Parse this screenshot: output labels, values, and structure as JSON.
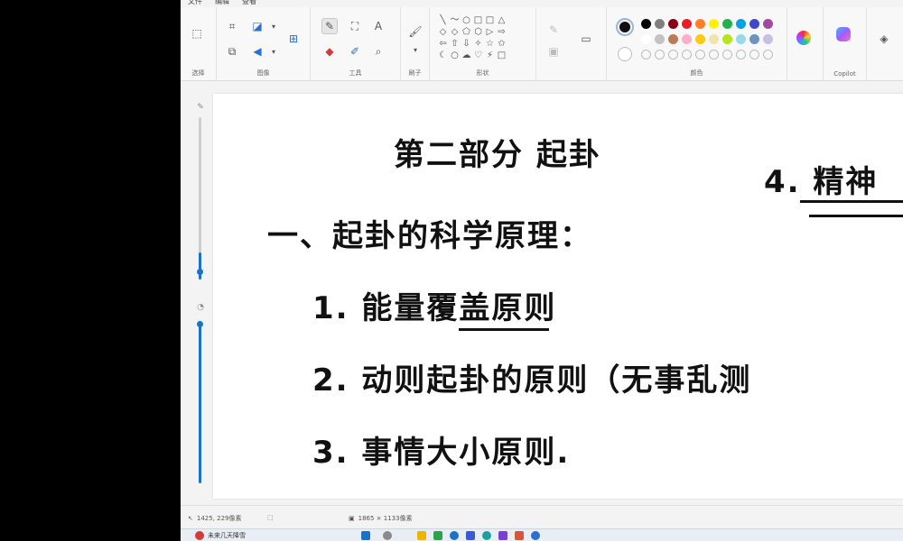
{
  "menu": [
    "文件",
    "编辑",
    "查看"
  ],
  "ribbon": {
    "groups": {
      "selection": "选择",
      "image": "图像",
      "tools": "工具",
      "brushes": "刷子",
      "shapes": "形状",
      "colors": "颜色",
      "copilot": "Copilot"
    },
    "text_tool_glyph": "A",
    "shape_glyphs": [
      "╲",
      "〜",
      "○",
      "□",
      "□",
      "△",
      "◇",
      "◇",
      "⬠",
      "⬡",
      "▷",
      "⇨",
      "⇦",
      "⇧",
      "⇩",
      "✧",
      "☆",
      "✩",
      "☾",
      "○",
      "☁",
      "♡",
      "⚡",
      "□"
    ],
    "colors": {
      "primary": "#111111",
      "row1": [
        "#000000",
        "#7f7f7f",
        "#880015",
        "#ed1c24",
        "#ff7f27",
        "#fff200",
        "#22b14c",
        "#00a2e8",
        "#3f48cc",
        "#a349a4"
      ],
      "row2": [
        "#ffffff",
        "#c3c3c3",
        "#b97a57",
        "#ffaec9",
        "#ffc90e",
        "#efe4b0",
        "#b5e61d",
        "#99d9ea",
        "#7092be",
        "#c8bfe7"
      ]
    }
  },
  "canvas": {
    "title_line": "第二部分  起卦",
    "side_heading": "4. 精神",
    "heading": "一、起卦的科学原理：",
    "items": [
      "1. 能量覆盖原则",
      "2. 动则起卦的原则（无事乱测",
      "3. 事情大小原则."
    ]
  },
  "status": {
    "cursor_pos": "1425, 229像素",
    "canvas_size": "1865 × 1133像素"
  },
  "taskbar": {
    "weather": "未来几天降雪"
  },
  "accent": "#1a73c9"
}
